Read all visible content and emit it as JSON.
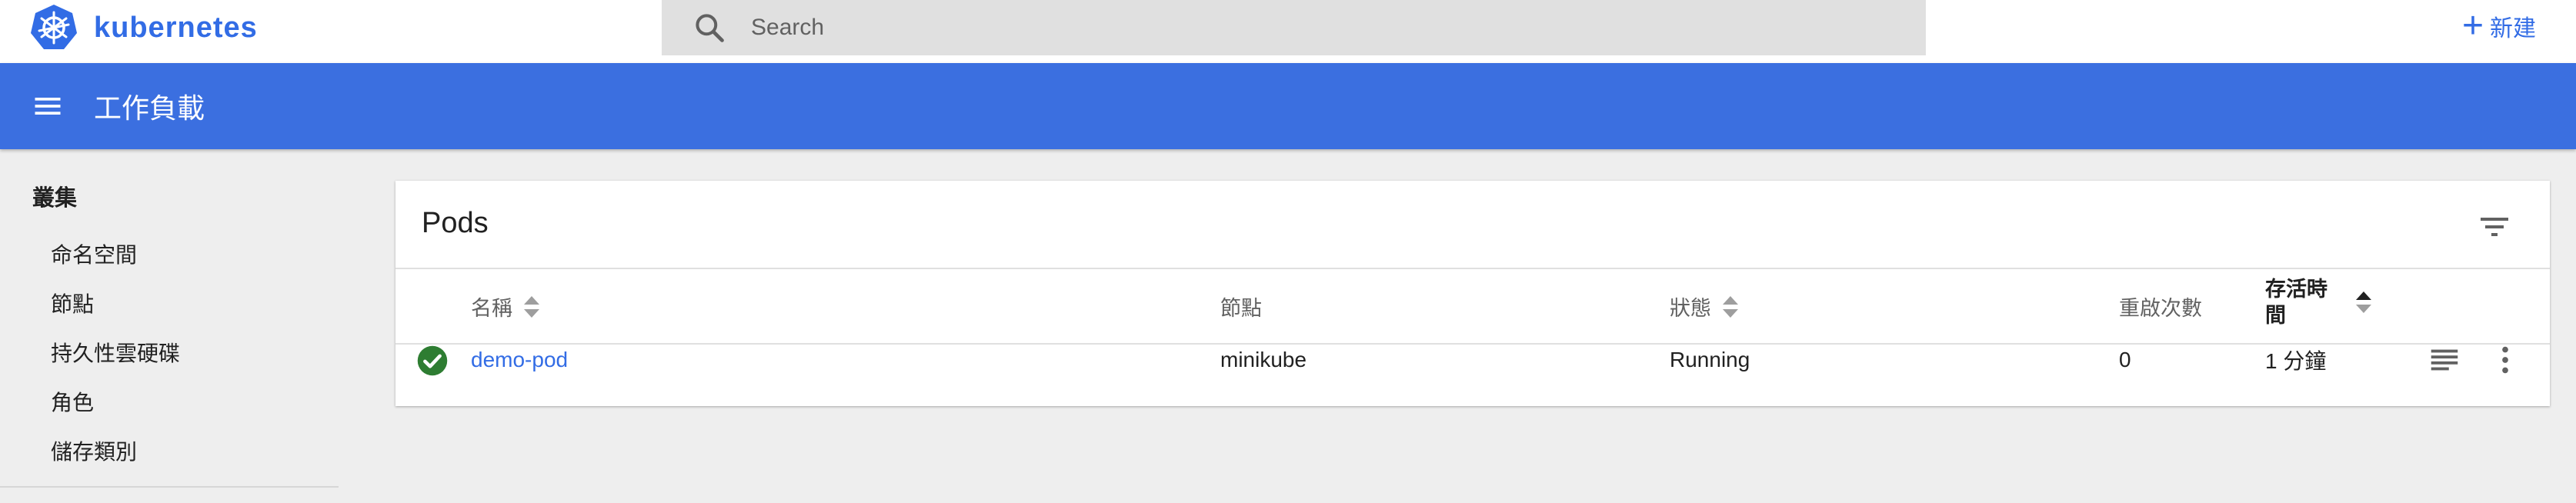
{
  "topbar": {
    "brand": "kubernetes",
    "search_placeholder": "Search",
    "new_label": "新建",
    "icons": [
      "kubernetes-logo-icon",
      "search-icon",
      "plus-icon"
    ]
  },
  "header": {
    "title": "工作負載"
  },
  "sidebar": {
    "section": "叢集",
    "items": [
      {
        "label": "命名空間"
      },
      {
        "label": "節點"
      },
      {
        "label": "持久性雲硬碟"
      },
      {
        "label": "角色"
      },
      {
        "label": "儲存類別"
      }
    ]
  },
  "card": {
    "title": "Pods",
    "columns": {
      "name": "名稱",
      "node": "節點",
      "status": "狀態",
      "restarts": "重啟次數",
      "age_line1": "存活時",
      "age_line2": "間"
    },
    "rows": [
      {
        "status_icon": "check-circle-icon",
        "name": "demo-pod",
        "node": "minikube",
        "status": "Running",
        "restarts": "0",
        "age": "1 分鐘"
      }
    ]
  },
  "colors": {
    "brand_blue": "#326ce5",
    "header_blue": "#3b6fe0",
    "status_green": "#2e7d32"
  }
}
